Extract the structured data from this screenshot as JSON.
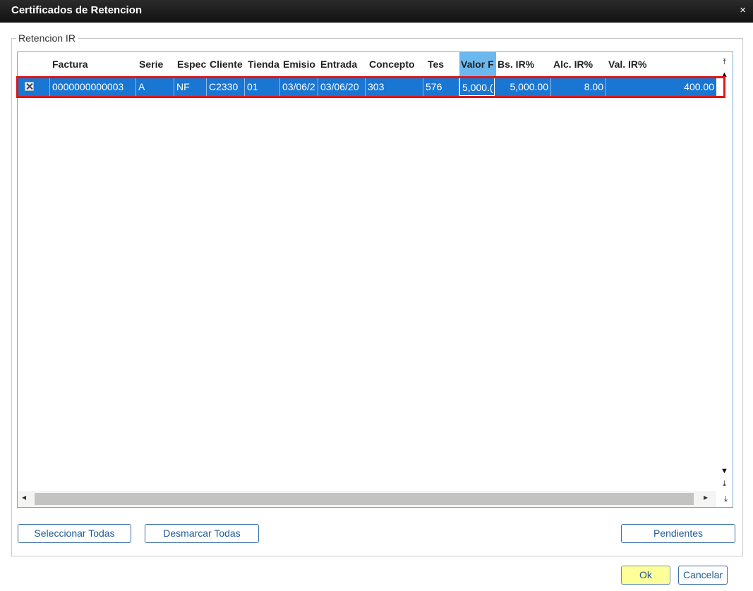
{
  "window": {
    "title": "Certificados de Retencion",
    "close_glyph": "×"
  },
  "group": {
    "label": "Retencion IR"
  },
  "table": {
    "headers": [
      "Factura",
      "Serie",
      "Espec",
      "Cliente",
      "Tienda",
      "Emisio",
      "Entrada",
      "Concepto",
      "Tes",
      "Valor F",
      "Bs. IR%",
      "Alc. IR%",
      "Val. IR%"
    ],
    "rows": [
      {
        "checked": true,
        "factura": "0000000000003",
        "serie": "A",
        "espec": "NF",
        "cliente": "C2330",
        "tienda": "01",
        "emision": "03/06/2",
        "entrada": "03/06/20",
        "concepto": "303",
        "tes": "576",
        "valor_f": "5,000.(",
        "bs_ir": "5,000.00",
        "alc_ir": "8.00",
        "val_ir": "400.00"
      }
    ],
    "active_column": "Valor F",
    "selection_color": "#1976d2",
    "highlight_color": "#e01515"
  },
  "buttons": {
    "select_all": "Seleccionar Todas",
    "unselect_all": "Desmarcar Todas",
    "pending": "Pendientes",
    "ok": "Ok",
    "cancel": "Cancelar"
  }
}
